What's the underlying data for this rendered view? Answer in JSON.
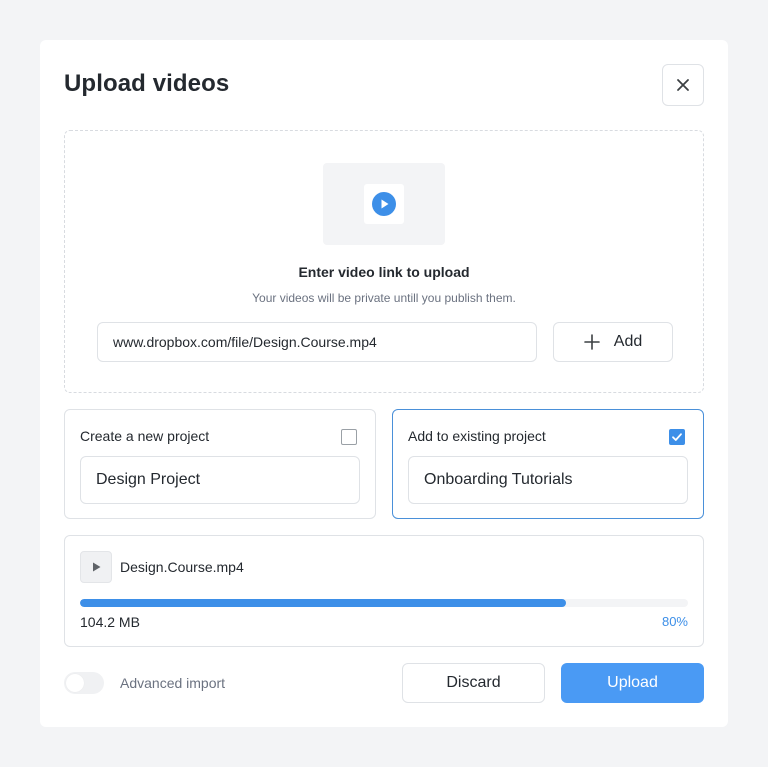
{
  "modal": {
    "title": "Upload videos",
    "close_icon": "close-icon"
  },
  "dropzone": {
    "thumbnail_icon": "play-circle-icon",
    "heading": "Enter video link to upload",
    "subtext": "Your videos will be private untill you publish them.",
    "link_value": "www.dropbox.com/file/Design.Course.mp4",
    "add_icon": "plus-icon",
    "add_label": "Add"
  },
  "new_project": {
    "label": "Create a new project",
    "checked": false,
    "input_value": "Design Project"
  },
  "existing_project": {
    "label": "Add to existing project",
    "checked": true,
    "input_value": "Onboarding Tutorials"
  },
  "file": {
    "play_icon": "play-icon",
    "name": "Design.Course.mp4",
    "size": "104.2 MB",
    "progress_percent": 80,
    "progress_label": "80%"
  },
  "footer": {
    "toggle_on": false,
    "toggle_label": "Advanced import",
    "discard_label": "Discard",
    "upload_label": "Upload"
  },
  "colors": {
    "accent": "#3d8fe8",
    "upload_button": "#4a9af4",
    "border": "#dfe2e6"
  }
}
